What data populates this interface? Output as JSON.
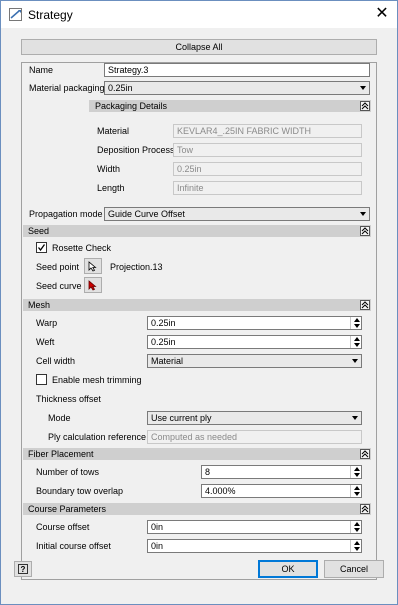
{
  "window": {
    "title": "Strategy",
    "close_glyph": "✕"
  },
  "collapse_all": "Collapse All",
  "name": {
    "label": "Name",
    "value": "Strategy.3"
  },
  "material_packaging": {
    "label": "Material packaging",
    "value": "0.25in"
  },
  "packaging_details": {
    "title": "Packaging Details",
    "material": {
      "label": "Material",
      "value": "KEVLAR4_.25IN FABRIC WIDTH"
    },
    "deposition_process": {
      "label": "Deposition Process",
      "value": "Tow"
    },
    "width": {
      "label": "Width",
      "value": "0.25in"
    },
    "length": {
      "label": "Length",
      "value": "Infinite"
    }
  },
  "propagation_mode": {
    "label": "Propagation mode",
    "value": "Guide Curve Offset"
  },
  "seed": {
    "title": "Seed",
    "rosette_check": {
      "label": "Rosette Check",
      "checked": true
    },
    "seed_point": {
      "label": "Seed point",
      "value": "Projection.13"
    },
    "seed_curve": {
      "label": "Seed curve"
    }
  },
  "mesh": {
    "title": "Mesh",
    "warp": {
      "label": "Warp",
      "value": "0.25in"
    },
    "weft": {
      "label": "Weft",
      "value": "0.25in"
    },
    "cell_width": {
      "label": "Cell width",
      "value": "Material"
    },
    "enable_mesh_trimming": {
      "label": "Enable mesh trimming",
      "checked": false
    },
    "thickness_offset": {
      "label": "Thickness offset"
    },
    "mode": {
      "label": "Mode",
      "value": "Use current ply"
    },
    "ply_calc_ref": {
      "label": "Ply calculation reference",
      "value": "Computed as needed"
    }
  },
  "fiber_placement": {
    "title": "Fiber Placement",
    "number_of_tows": {
      "label": "Number of tows",
      "value": "8"
    },
    "boundary_tow_overlap": {
      "label": "Boundary tow overlap",
      "value": "4.000%"
    }
  },
  "course_parameters": {
    "title": "Course Parameters",
    "course_offset": {
      "label": "Course offset",
      "value": "0in"
    },
    "initial_course_offset": {
      "label": "Initial course offset",
      "value": "0in"
    }
  },
  "footer": {
    "help_glyph": "?",
    "ok": "OK",
    "cancel": "Cancel"
  },
  "colors": {
    "accent": "#0078d7",
    "section_bg": "#cfcfcf",
    "cursor_red": "#cc0000"
  }
}
